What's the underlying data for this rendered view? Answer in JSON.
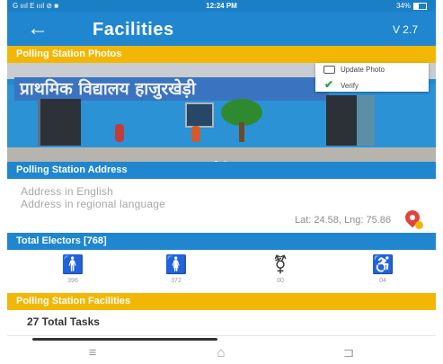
{
  "status_bar": {
    "carrier": "G ıııl E ıııl ⊘ ■",
    "time": "12:24 PM",
    "battery": "34%"
  },
  "appbar": {
    "back_icon": "←",
    "title": "Facilities",
    "version": "V 2.7"
  },
  "photos": {
    "section_title": "Polling Station Photos",
    "banner_text": "प्राथमिक विद्यालय हाजुरखेड़ी",
    "menu": {
      "update_photo": "Update Photo",
      "verify": "Verify"
    },
    "carousel_index": 1,
    "carousel_count": 2
  },
  "address": {
    "section_title": "Polling Station Address",
    "english_placeholder": "Address in English",
    "regional_placeholder": "Address in regional language",
    "latlng": "Lat: 24.58, Lng: 75.86"
  },
  "electors": {
    "section_title": "Total Electors [768]",
    "stats": [
      {
        "icon": "male-icon",
        "value": "396"
      },
      {
        "icon": "female-icon",
        "value": "372"
      },
      {
        "icon": "third-gender-icon",
        "value": "00"
      },
      {
        "icon": "wheelchair-icon",
        "value": "04"
      }
    ]
  },
  "facilities": {
    "section_title": "Polling Station Facilities",
    "tasks_label": "27 Total Tasks"
  },
  "nav": {
    "menu_icon": "≡",
    "home_icon": "⌂",
    "back_icon": "⊐"
  },
  "colors": {
    "primary": "#1f86cf",
    "accent": "#f2b705",
    "status": "#1b7fc6"
  }
}
